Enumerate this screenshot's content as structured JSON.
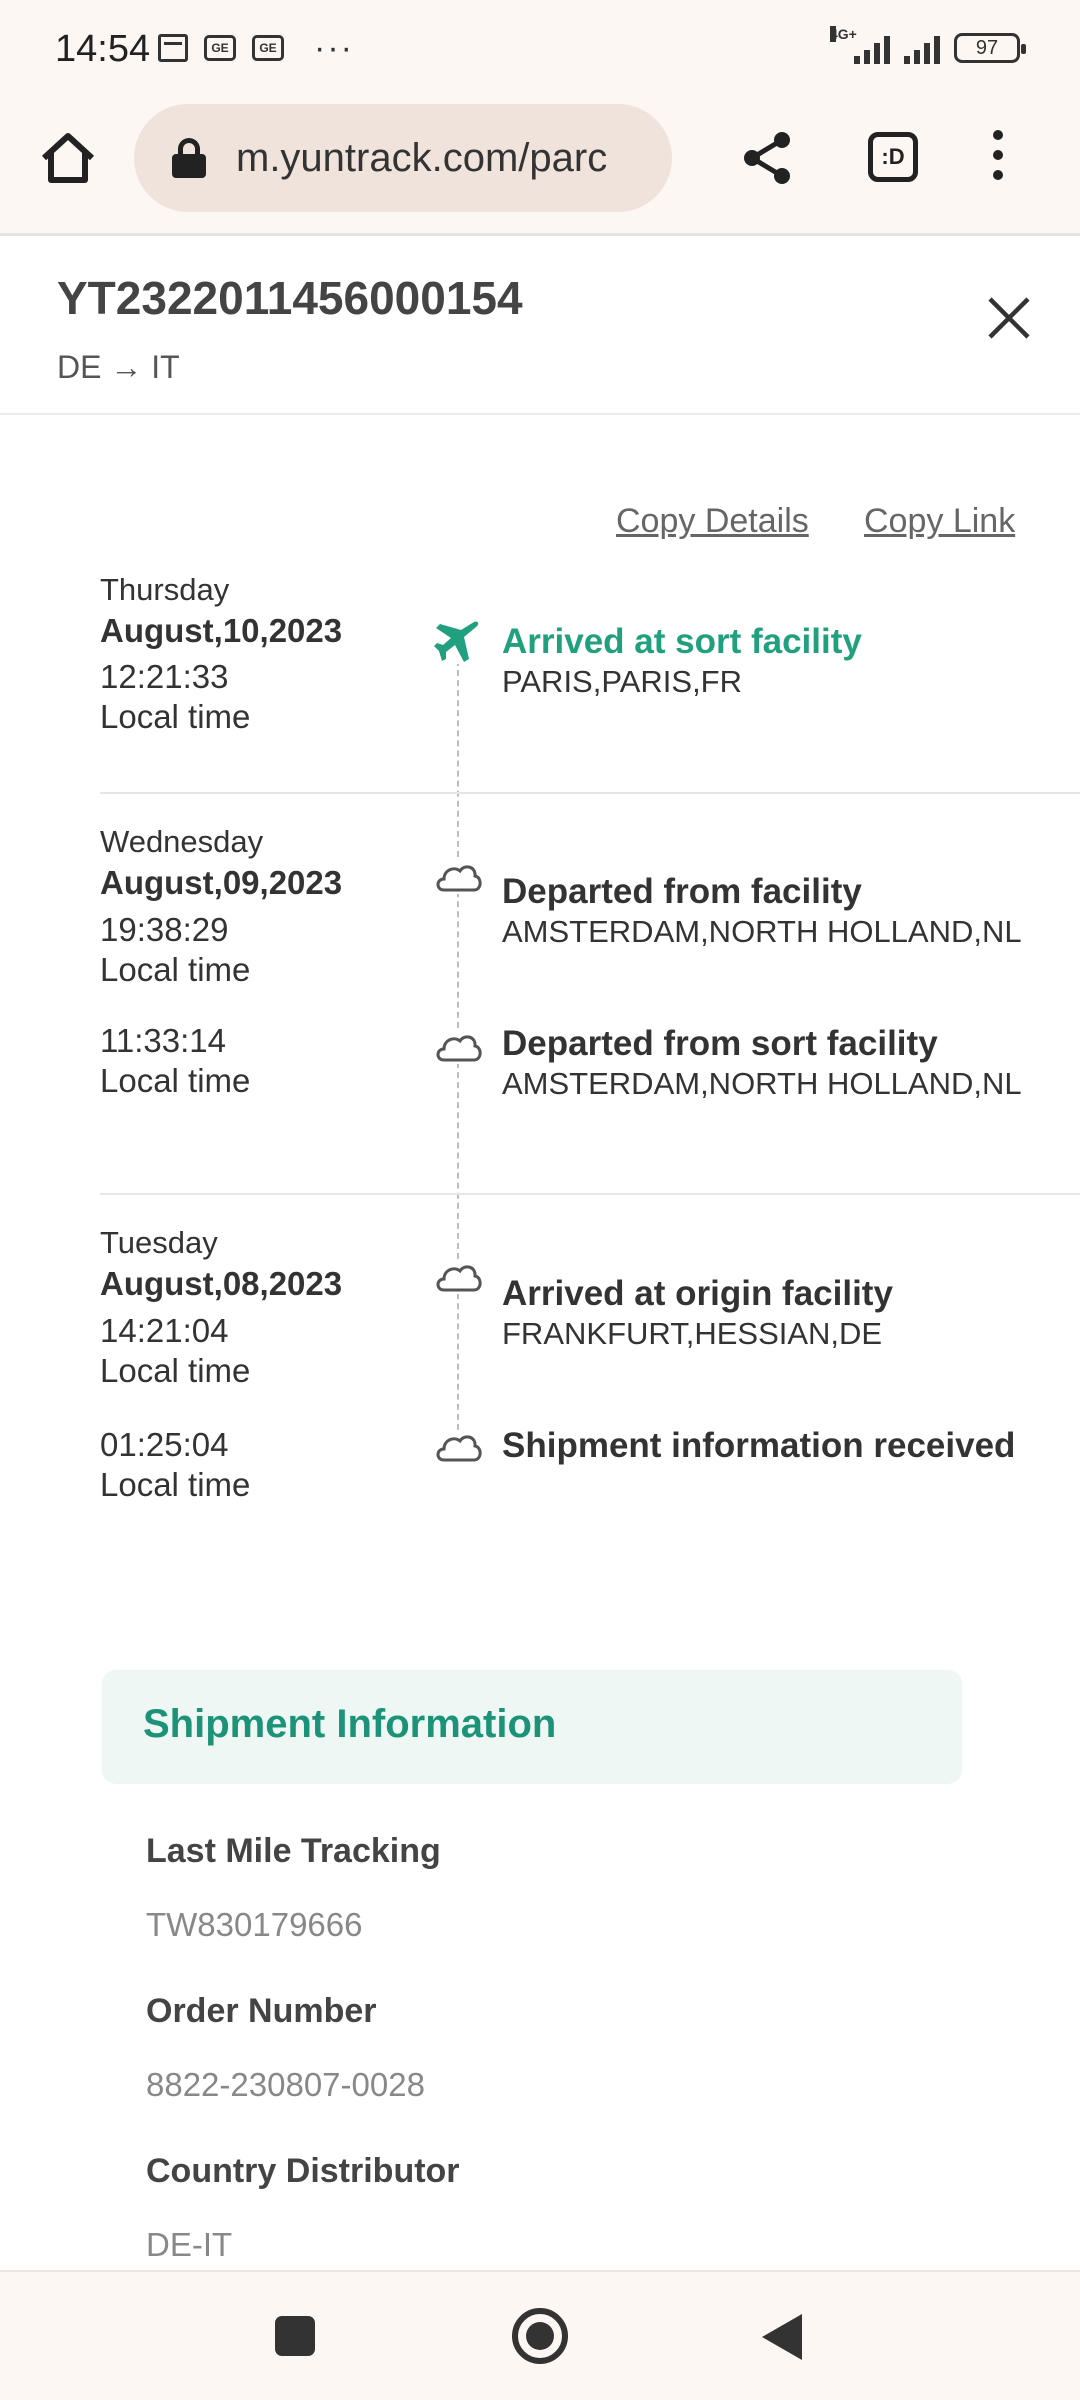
{
  "status_bar": {
    "time": "14:54",
    "network": "4G+",
    "battery": "97"
  },
  "browser": {
    "url": "m.yuntrack.com/parc",
    "tabs_label": ":D"
  },
  "header": {
    "tracking_number": "YT2322011456000154",
    "route": "DE → IT"
  },
  "actions": {
    "copy_details": "Copy Details",
    "copy_link": "Copy Link"
  },
  "timeline": {
    "local_time_label": "Local time",
    "days": [
      {
        "weekday": "Thursday",
        "date": "August,10,2023",
        "events": [
          {
            "time": "12:21:33",
            "title": "Arrived at sort facility",
            "location": "PARIS,PARIS,FR",
            "icon": "plane-icon",
            "active": true
          }
        ]
      },
      {
        "weekday": "Wednesday",
        "date": "August,09,2023",
        "events": [
          {
            "time": "19:38:29",
            "title": "Departed from facility",
            "location": "AMSTERDAM,NORTH HOLLAND,NL",
            "icon": "cloud-icon",
            "active": false
          },
          {
            "time": "11:33:14",
            "title": "Departed from sort facility",
            "location": "AMSTERDAM,NORTH HOLLAND,NL",
            "icon": "cloud-icon",
            "active": false
          }
        ]
      },
      {
        "weekday": "Tuesday",
        "date": "August,08,2023",
        "events": [
          {
            "time": "14:21:04",
            "title": "Arrived at origin facility",
            "location": "FRANKFURT,HESSIAN,DE",
            "icon": "cloud-icon",
            "active": false
          },
          {
            "time": "01:25:04",
            "title": "Shipment information received",
            "location": "",
            "icon": "cloud-icon",
            "active": false
          }
        ]
      }
    ]
  },
  "shipment_info": {
    "title": "Shipment Information",
    "fields": [
      {
        "label": "Last Mile Tracking",
        "value": "TW830179666"
      },
      {
        "label": "Order Number",
        "value": "8822-230807-0028"
      },
      {
        "label": "Country Distributor",
        "value": "DE-IT"
      }
    ]
  },
  "colors": {
    "accent": "#20a07f",
    "info_title": "#1c9378",
    "info_bg": "#eef7f4",
    "browser_bg": "#fdf7f4",
    "url_bg": "#efe3dc"
  }
}
